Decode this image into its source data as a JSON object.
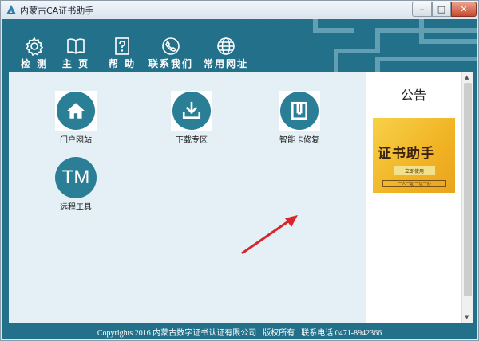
{
  "window": {
    "title": "内蒙古CA证书助手",
    "min_label": "–",
    "max_label": "□",
    "close_label": "✕"
  },
  "nav": [
    {
      "label": "检 测",
      "icon": "gear-icon"
    },
    {
      "label": "主 页",
      "icon": "book-icon"
    },
    {
      "label": "帮 助",
      "icon": "help-icon"
    },
    {
      "label": "联系我们",
      "icon": "phone-icon"
    },
    {
      "label": "常用网址",
      "icon": "globe-icon"
    }
  ],
  "tiles": [
    {
      "label": "门户网站",
      "icon": "home-icon"
    },
    {
      "label": "下载专区",
      "icon": "download-icon"
    },
    {
      "label": "智能卡修复",
      "icon": "card-repair-icon"
    },
    {
      "label": "远程工具",
      "icon": "tm-icon",
      "icon_text": "TM"
    }
  ],
  "notice": {
    "title": "公告",
    "banner_title": "证书助手",
    "banner_button": "立即使用",
    "banner_footer": "一人一证 一证一办"
  },
  "footer": {
    "copyright": "Copyrights 2016 内蒙古数字证书认证有限公司",
    "rights": "版权所有",
    "phone": "联系电话  0471-8942366"
  },
  "colors": {
    "app_bg": "#23708a",
    "tile_circle": "#2a7f96",
    "content_bg": "#e4f0f5",
    "arrow": "#d9252a"
  }
}
